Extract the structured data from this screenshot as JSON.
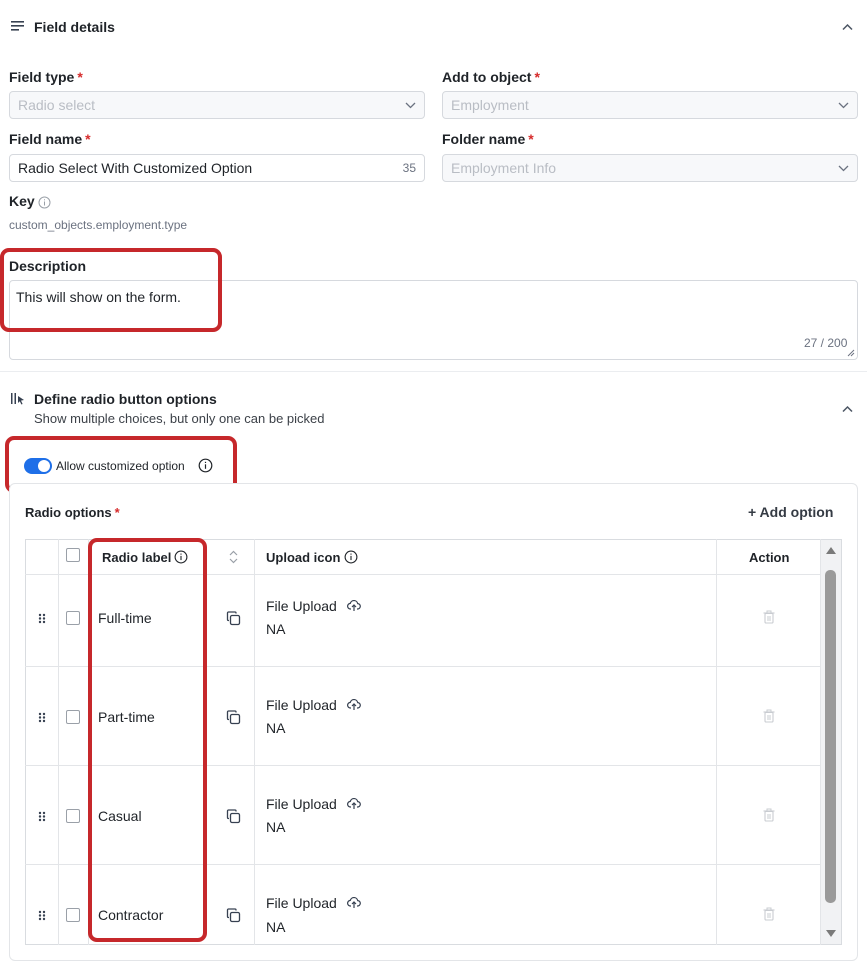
{
  "field_details": {
    "title": "Field details",
    "field_type": {
      "label": "Field type",
      "value": "Radio select"
    },
    "add_to_object": {
      "label": "Add to object",
      "value": "Employment"
    },
    "field_name": {
      "label": "Field name",
      "value": "Radio Select With Customized Option",
      "counter": "35"
    },
    "folder_name": {
      "label": "Folder name",
      "value": "Employment Info"
    },
    "key": {
      "label": "Key",
      "value": "custom_objects.employment.type"
    },
    "description": {
      "label": "Description",
      "value": "This will show on the form.",
      "counter": "27 / 200"
    },
    "required_mark": "*"
  },
  "radio_section": {
    "title": "Define radio button options",
    "subtitle": "Show multiple choices, but only one can be picked",
    "allow_custom_label": "Allow customized option",
    "allow_custom_enabled": true,
    "options_label": "Radio options",
    "add_option_label": "+ Add option",
    "table": {
      "headers": {
        "label": "Radio label",
        "icon": "Upload icon",
        "action": "Action"
      },
      "rows": [
        {
          "label": "Full-time",
          "upload": "File Upload",
          "icon_value": "NA"
        },
        {
          "label": "Part-time",
          "upload": "File Upload",
          "icon_value": "NA"
        },
        {
          "label": "Casual",
          "upload": "File Upload",
          "icon_value": "NA"
        },
        {
          "label": "Contractor",
          "upload": "File Upload",
          "icon_value": "NA"
        }
      ]
    }
  },
  "colors": {
    "accent": "#1e6fe8",
    "required": "#d62b2b",
    "annotation": "#c6282b"
  }
}
